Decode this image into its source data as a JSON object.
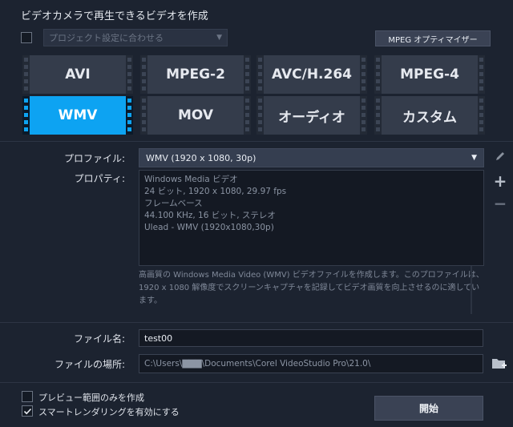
{
  "header": {
    "title": "ビデオカメラで再生できるビデオを作成",
    "project_dropdown_placeholder": "プロジェクト設定に合わせる",
    "mpeg_optimizer_label": "MPEG オプティマイザー"
  },
  "formats": [
    {
      "label": "AVI",
      "selected": false
    },
    {
      "label": "MPEG-2",
      "selected": false
    },
    {
      "label": "AVC/H.264",
      "selected": false
    },
    {
      "label": "MPEG-4",
      "selected": false
    },
    {
      "label": "WMV",
      "selected": true
    },
    {
      "label": "MOV",
      "selected": false
    },
    {
      "label": "オーディオ",
      "selected": false
    },
    {
      "label": "カスタム",
      "selected": false
    }
  ],
  "profile": {
    "label": "プロファイル:",
    "value": "WMV (1920 x 1080, 30p)"
  },
  "properties": {
    "label": "プロパティ:",
    "lines": [
      "Windows Media ビデオ",
      "24 ビット, 1920 x 1080, 29.97 fps",
      "フレームベース",
      "44.100 KHz, 16 ビット, ステレオ",
      "Ulead - WMV (1920x1080,30p)"
    ],
    "description": "高画質の Windows Media Video (WMV) ビデオファイルを作成します。このプロファイルは、1920 x 1080 解像度でスクリーンキャプチャを記録してビデオ画質を向上させるのに適しています。"
  },
  "file": {
    "name_label": "ファイル名:",
    "name_value": "test00",
    "location_label": "ファイルの場所:",
    "location_value": "C:\\Users\\▇▇▇\\Documents\\Corel VideoStudio Pro\\21.0\\"
  },
  "options": {
    "preview_range_label": "プレビュー範囲のみを作成",
    "preview_range_checked": false,
    "smart_render_label": "スマートレンダリングを有効にする",
    "smart_render_checked": true
  },
  "actions": {
    "start_label": "開始"
  },
  "colors": {
    "background": "#1c2330",
    "tile": "#343c4b",
    "tile_selected": "#0da3f2"
  }
}
